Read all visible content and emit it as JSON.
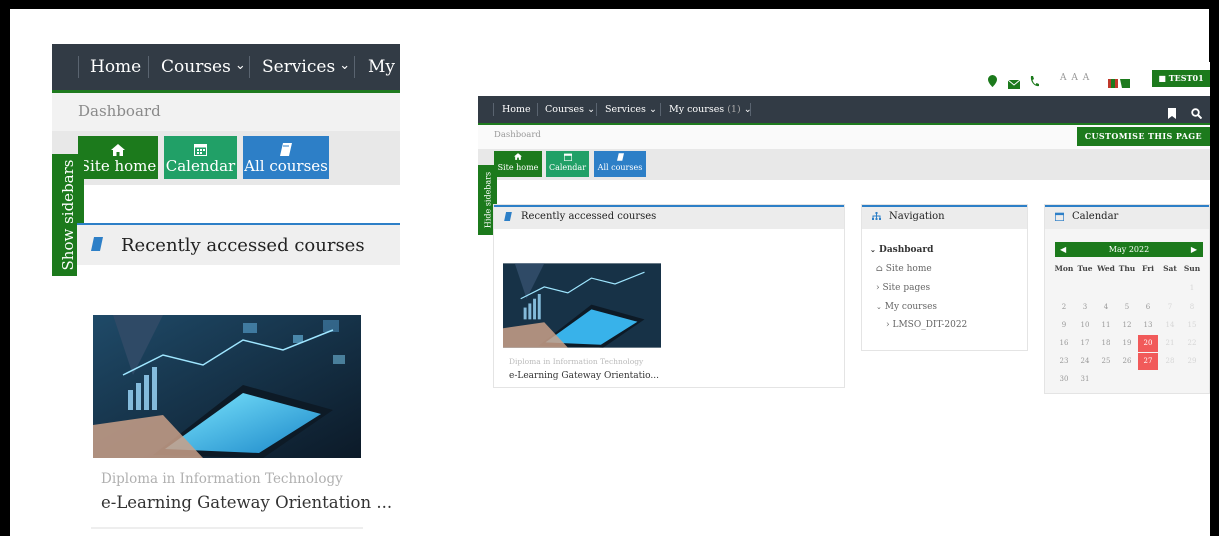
{
  "colors": {
    "nav_bg": "#323b45",
    "green": "#1c7a1c",
    "teal": "#21a067",
    "blue": "#2d7fc7",
    "today": "#f15a5a"
  },
  "left": {
    "nav": {
      "home": "Home",
      "courses": "Courses",
      "services": "Services",
      "my": "My c",
      "chevron": "⌄"
    },
    "breadcrumb": "Dashboard",
    "buttons": {
      "site_home": "Site home",
      "calendar": "Calendar",
      "all_courses": "All courses"
    },
    "show_sidebars": "Show sidebars",
    "recent_title": "Recently accessed courses",
    "course": {
      "category": "Diploma in Information Technology",
      "name": "e-Learning Gateway Orientation ..."
    }
  },
  "right": {
    "top": {
      "font_sizes": "A A A",
      "user": "TEST01"
    },
    "nav": {
      "home": "Home",
      "courses": "Courses",
      "services": "Services",
      "my_courses": "My courses",
      "my_courses_count": "(1)"
    },
    "breadcrumb": "Dashboard",
    "customise": "CUSTOMISE THIS PAGE",
    "buttons": {
      "site_home": "Site home",
      "calendar": "Calendar",
      "all_courses": "All courses"
    },
    "hide_sidebars": "Hide sidebars",
    "recent_title": "Recently accessed courses",
    "course": {
      "category": "Diploma in Information Technology",
      "name": "e-Learning Gateway Orientatio..."
    },
    "navigation": {
      "title": "Navigation",
      "dashboard": "Dashboard",
      "site_home": "Site home",
      "site_pages": "Site pages",
      "my_courses": "My courses",
      "course": "LMSO_DIT-2022"
    },
    "calendar": {
      "title": "Calendar",
      "month": "May 2022",
      "day_names": [
        "Mon",
        "Tue",
        "Wed",
        "Thu",
        "Fri",
        "Sat",
        "Sun"
      ]
    }
  }
}
